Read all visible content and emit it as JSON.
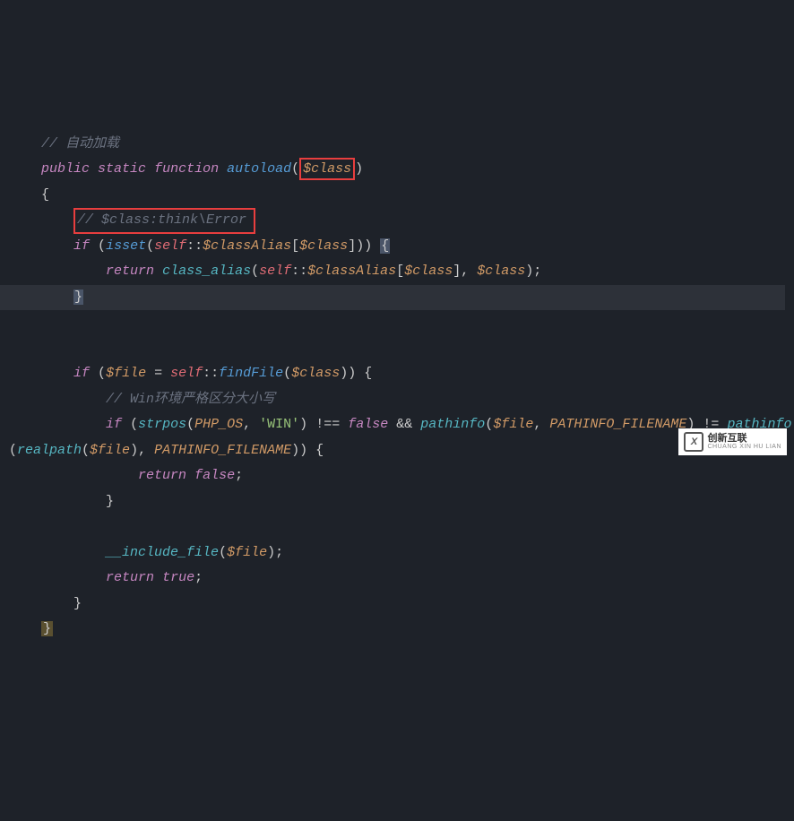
{
  "code": {
    "line1_comment": "// 自动加载",
    "line2_public": "public",
    "line2_static": "static",
    "line2_function": "function",
    "line2_name": "autoload",
    "line2_param": "$class",
    "line3_brace": "{",
    "line4_comment": "// $class:think\\Error",
    "line5_if": "if",
    "line5_isset": "isset",
    "line5_self": "self",
    "line5_scope": "::",
    "line5_classAlias": "$classAlias",
    "line5_class": "$class",
    "line5_brace": "{",
    "line6_return": "return",
    "line6_func": "class_alias",
    "line6_self": "self",
    "line6_scope": "::",
    "line6_classAlias": "$classAlias",
    "line6_class": "$class",
    "line6_class2": "$class",
    "line7_brace": "}",
    "line9_if": "if",
    "line9_file": "$file",
    "line9_self": "self",
    "line9_scope": "::",
    "line9_findFile": "findFile",
    "line9_class": "$class",
    "line10_comment": "// Win环境严格区分大小写",
    "line11_if": "if",
    "line11_strpos": "strpos",
    "line11_phpos": "PHP_OS",
    "line11_win": "'WIN'",
    "line11_neq": "!==",
    "line11_false": "false",
    "line11_and": "&&",
    "line11_pathinfo": "pathinfo",
    "line11_file": "$file",
    "line11_pfn": "PATHINFO_FILENAME",
    "line11_ne": "!=",
    "line11_pathinfo2": "pathinfo",
    "line12_realpath": "realpath",
    "line12_file": "$file",
    "line12_pfn": "PATHINFO_FILENAME",
    "line13_return": "return",
    "line13_false": "false",
    "line14_brace": "}",
    "line16_include": "__include_file",
    "line16_file": "$file",
    "line17_return": "return",
    "line17_true": "true",
    "line18_brace": "}",
    "line19_brace": "}"
  },
  "logo": {
    "icon": "X",
    "cn": "创新互联",
    "en": "CHUANG XIN HU LIAN"
  }
}
